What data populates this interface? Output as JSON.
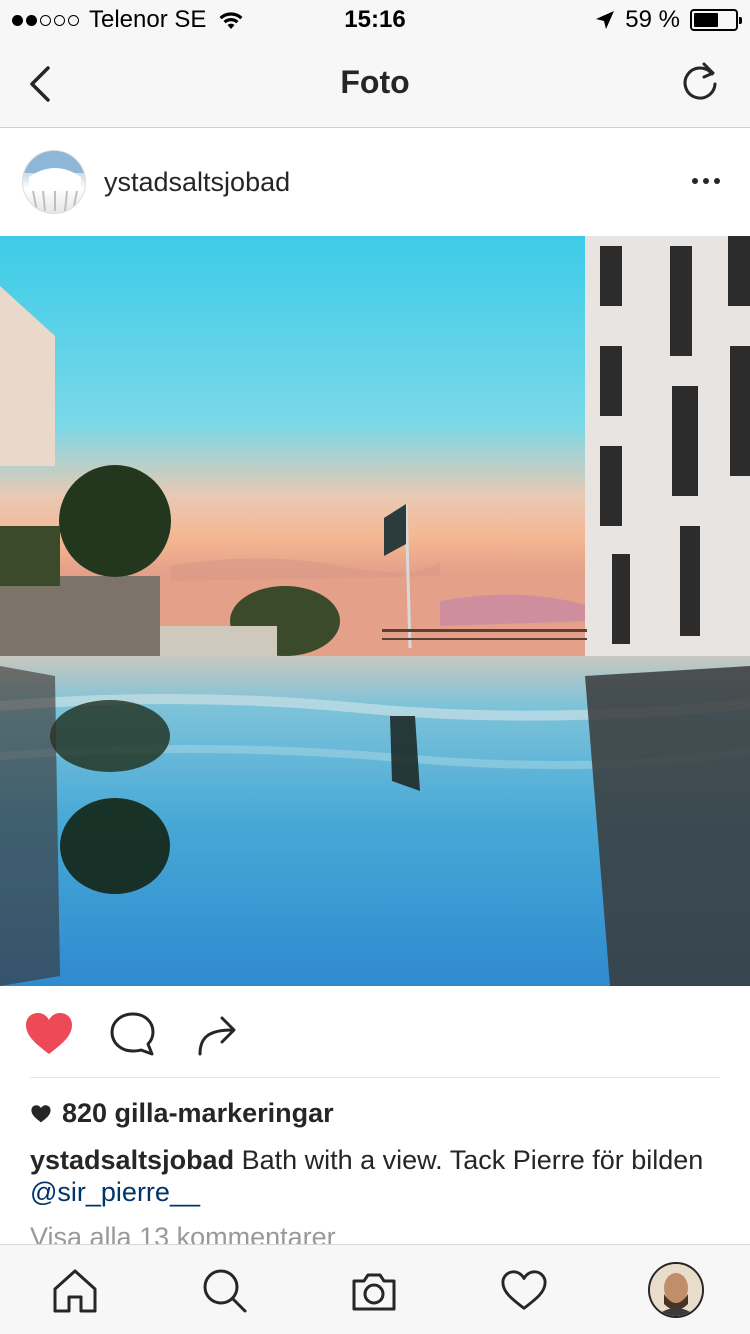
{
  "status_bar": {
    "carrier": "Telenor SE",
    "time": "15:16",
    "battery_percent_text": "59 %",
    "battery_level": 0.59,
    "signal_bars": 2,
    "signal_total": 5
  },
  "nav": {
    "title": "Foto",
    "back_icon": "chevron-left-icon",
    "refresh_icon": "refresh-icon"
  },
  "post": {
    "username": "ystadsaltsjobad",
    "more_icon": "more-horizontal-icon",
    "photo_description_icon": "photo",
    "liked": true,
    "like_color": "#ed4956",
    "likes_text": "820 gilla-markeringar",
    "caption_user": "ystadsaltsjobad",
    "caption_text": " Bath with a view. Tack Pierre för bilden ",
    "caption_mention": "@sir_pierre__",
    "view_comments": "Visa alla 13 kommentarer"
  },
  "tabs": [
    {
      "name": "home",
      "icon": "home-icon"
    },
    {
      "name": "search",
      "icon": "search-icon"
    },
    {
      "name": "camera",
      "icon": "camera-icon"
    },
    {
      "name": "activity",
      "icon": "heart-icon"
    },
    {
      "name": "profile",
      "icon": "profile-avatar"
    }
  ]
}
